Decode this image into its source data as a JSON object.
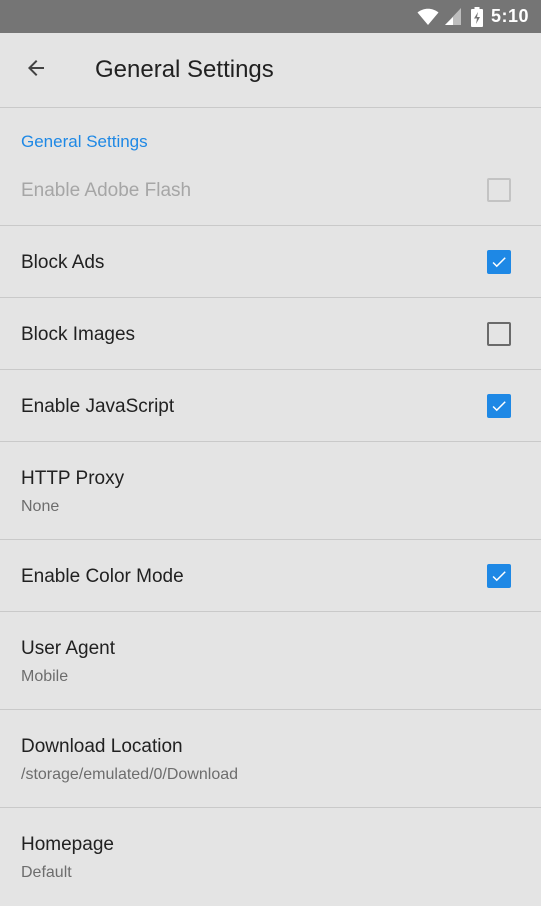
{
  "status_bar": {
    "time": "5:10",
    "icons": [
      "wifi-icon",
      "signal-icon",
      "battery-charging-icon"
    ]
  },
  "toolbar": {
    "back_icon": "arrow-back-icon",
    "title": "General Settings"
  },
  "section": {
    "header": "General Settings"
  },
  "prefs": [
    {
      "title": "Enable Adobe Flash",
      "checkbox": "disabled-unchecked"
    },
    {
      "title": "Block Ads",
      "checkbox": "checked"
    },
    {
      "title": "Block Images",
      "checkbox": "unchecked"
    },
    {
      "title": "Enable JavaScript",
      "checkbox": "checked"
    },
    {
      "title": "HTTP Proxy",
      "summary": "None"
    },
    {
      "title": "Enable Color Mode",
      "checkbox": "checked"
    },
    {
      "title": "User Agent",
      "summary": "Mobile"
    },
    {
      "title": "Download Location",
      "summary": "/storage/emulated/0/Download"
    },
    {
      "title": "Homepage",
      "summary": "Default"
    }
  ],
  "colors": {
    "accent": "#1e88e5",
    "background": "#e4e4e4",
    "status_bar": "#757575",
    "divider": "#c9c9c9"
  }
}
